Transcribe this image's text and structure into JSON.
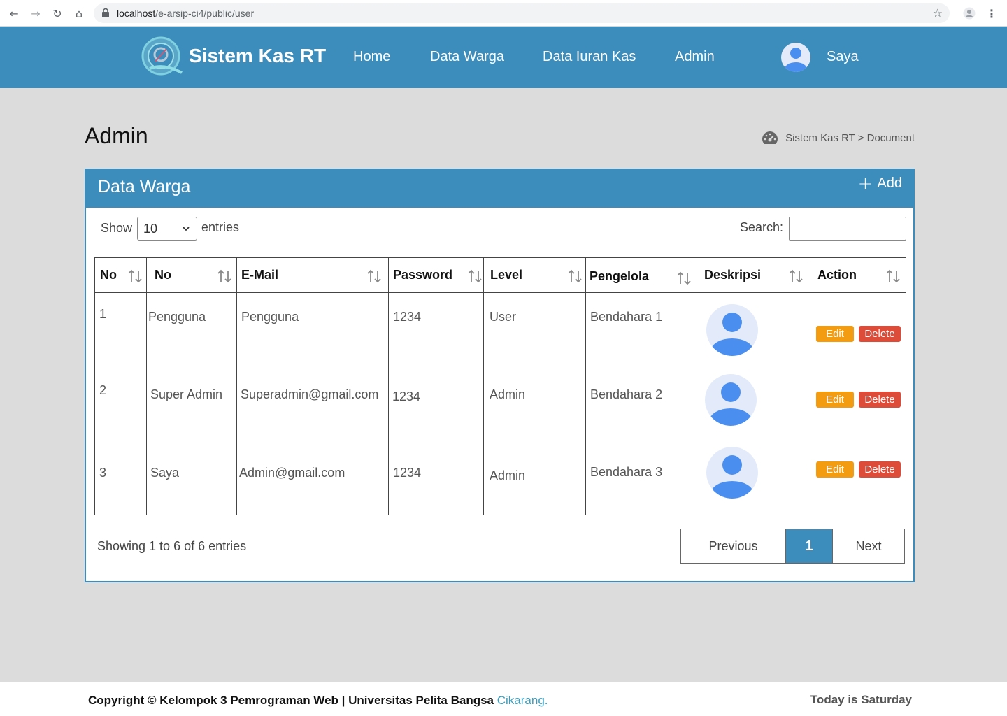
{
  "browser": {
    "url_host": "localhost",
    "url_path": "/e-arsip-ci4/public/user"
  },
  "navbar": {
    "brand": "Sistem Kas RT",
    "items": [
      "Home",
      "Data Warga",
      "Data Iuran Kas",
      "Admin"
    ],
    "user_name": "Saya"
  },
  "page": {
    "title": "Admin",
    "breadcrumb": "Sistem Kas RT > Document"
  },
  "box": {
    "title": "Data Warga",
    "add_label": "Add"
  },
  "table_controls": {
    "show_label": "Show",
    "entries_value": "10",
    "entries_label": "entries",
    "search_label": "Search:"
  },
  "table": {
    "headers": [
      "No",
      "No",
      "E-Mail",
      "Password",
      "Level",
      "Pengelola",
      "Deskripsi",
      "Action"
    ],
    "rows": [
      {
        "no": "1",
        "name": "Pengguna",
        "email": "Pengguna",
        "password": "1234",
        "level": "User",
        "pengelola": "Bendahara 1"
      },
      {
        "no": "2",
        "name": "Super Admin",
        "email": "Superadmin@gmail.com",
        "password": "1234",
        "level": "Admin",
        "pengelola": "Bendahara 2"
      },
      {
        "no": "3",
        "name": "Saya",
        "email": "Admin@gmail.com",
        "password": "1234",
        "level": "Admin",
        "pengelola": "Bendahara 3"
      }
    ],
    "edit_label": "Edit",
    "delete_label": "Delete"
  },
  "pagination": {
    "info": "Showing 1 to 6 of 6 entries",
    "previous": "Previous",
    "current": "1",
    "next": "Next"
  },
  "footer": {
    "copyright": "Copyright © Kelompok 3 Pemrograman Web | Universitas Pelita Bangsa ",
    "city": "Cikarang.",
    "today": "Today is Saturday"
  },
  "colors": {
    "primary": "#3c8dbc",
    "edit": "#f39c12",
    "delete": "#dd4b39",
    "avatar_bg": "#e3ebfa",
    "avatar_fg": "#4a8ff0"
  }
}
